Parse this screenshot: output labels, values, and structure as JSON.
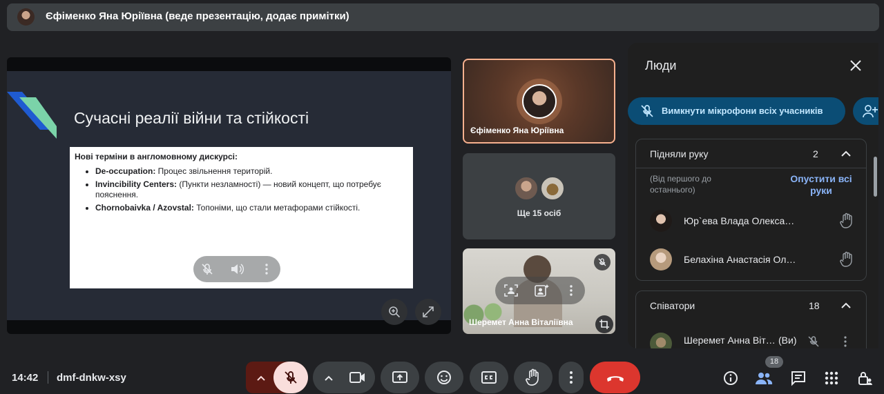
{
  "banner": {
    "presenter_text": "Єфіменко Яна Юріївна (веде презентацію, додає примітки)"
  },
  "slide": {
    "title": "Сучасні реалії війни та стійкості",
    "box_heading": "Нові терміни в англомовному дискурсі:",
    "bullets": [
      {
        "term": "De-occupation:",
        "text": " Процес звільнення територій."
      },
      {
        "term": "Invincibility Centers:",
        "text": " (Пункти незламності) — новий концепт, що потребує пояснення."
      },
      {
        "term": "Chornobaivka / Azovstal:",
        "text": " Топоніми, що стали метафорами стійкості."
      }
    ]
  },
  "tiles": {
    "presenter_name": "Єфіменко Яна Юріївна",
    "others_label": "Ще 15 осіб",
    "camera_name": "Шеремет Анна Віталіївна"
  },
  "panel": {
    "title": "Люди",
    "mute_all_label": "Вимкнути мікрофони всіх учасників",
    "raised_hands": {
      "title": "Підняли руку",
      "count": "2",
      "order_note": "(Від першого до останнього)",
      "lower_all": "Опустити всі руки",
      "people": [
        "Юр`ева Влада Олекса…",
        "Белахіна Анастасія Ол…"
      ]
    },
    "cohosts": {
      "title": "Співатори",
      "count": "18",
      "first_name": "Шеремет Анна Віт…",
      "you_tag": "(Ви)"
    }
  },
  "bottom": {
    "time": "14:42",
    "meeting_code": "dmf-dnkw-xsy",
    "people_badge": "18"
  },
  "colors": {
    "background": "#202124",
    "mic_off": "#f9dedc",
    "leave": "#dc362e",
    "link": "#8ab4f8",
    "mute_all_bg": "#0b4d75"
  }
}
